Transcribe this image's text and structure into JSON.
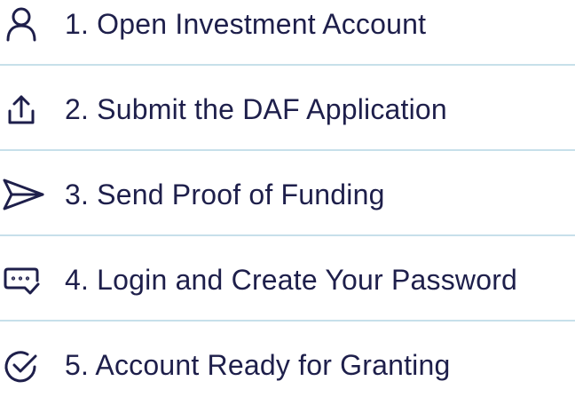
{
  "colors": {
    "text": "#1e1f4b",
    "icon": "#1e1f4b",
    "divider": "#c7e0ea",
    "background": "#ffffff"
  },
  "steps": [
    {
      "label": "1. Open Investment Account",
      "icon": "user-icon"
    },
    {
      "label": "2. Submit the DAF Application",
      "icon": "upload-icon"
    },
    {
      "label": "3. Send Proof of Funding",
      "icon": "send-icon"
    },
    {
      "label": "4. Login and Create Your Password",
      "icon": "password-icon"
    },
    {
      "label": "5. Account Ready for Granting",
      "icon": "check-circle-icon"
    }
  ]
}
